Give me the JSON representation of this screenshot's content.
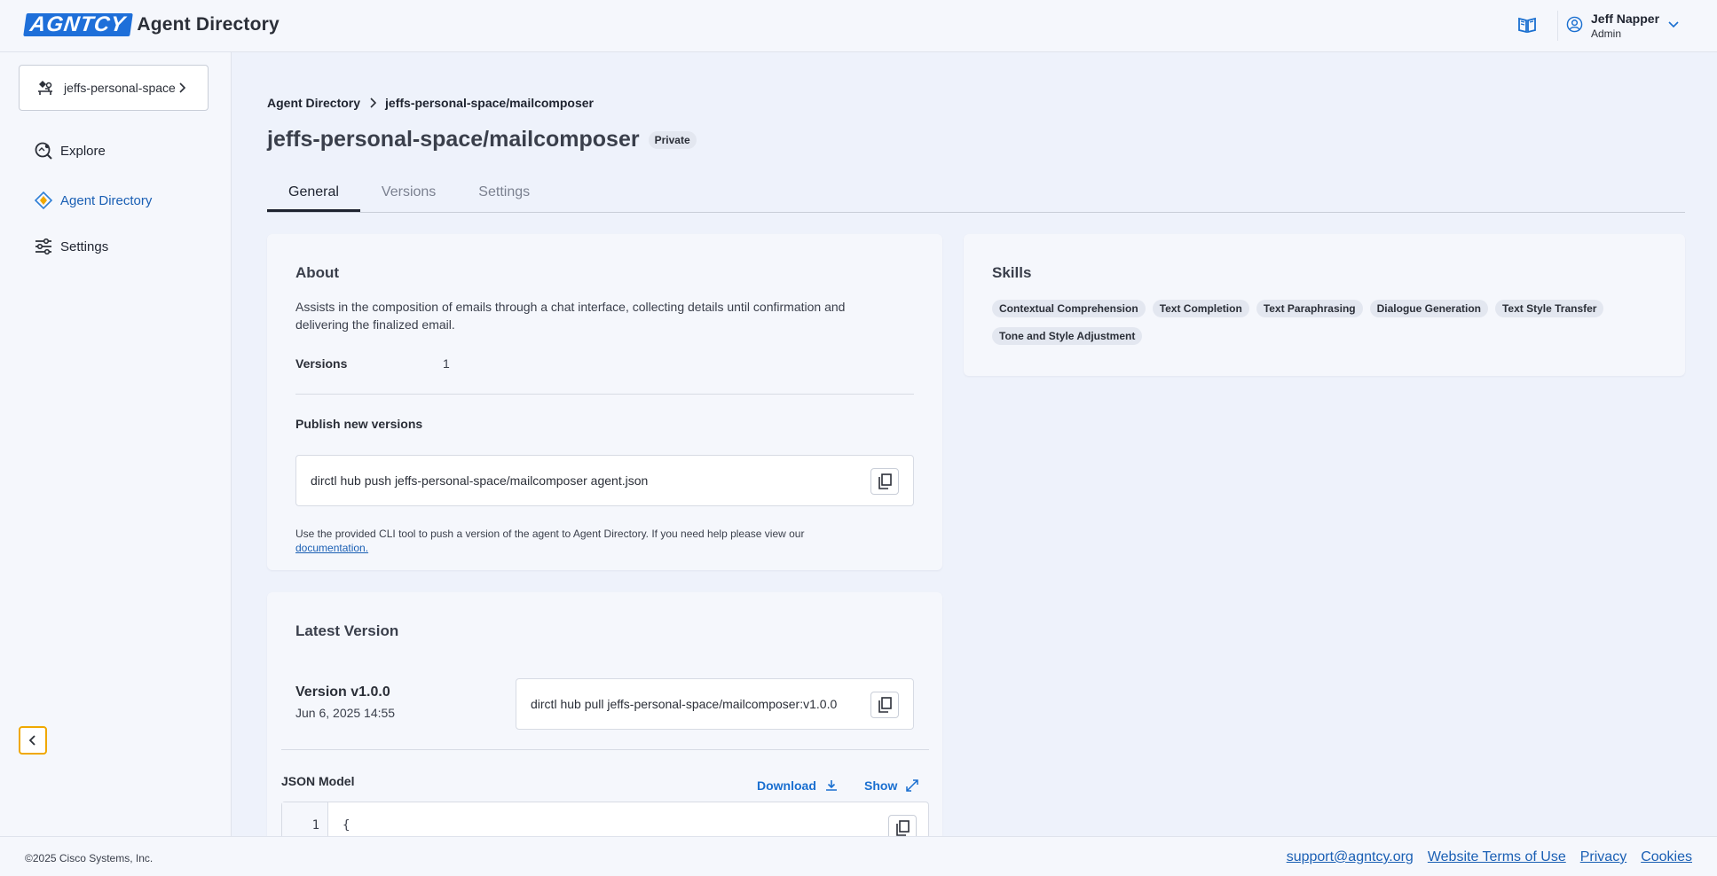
{
  "header": {
    "brand_badge": "AGNTCY",
    "brand_name": "Agent Directory",
    "book_icon": "book-icon",
    "user": {
      "name": "Jeff Napper",
      "role": "Admin"
    }
  },
  "sidebar": {
    "space": "jeffs-personal-space",
    "items": [
      {
        "label": "Explore",
        "icon": "explore-icon"
      },
      {
        "label": "Agent Directory",
        "icon": "agent-directory-icon",
        "active": true
      },
      {
        "label": "Settings",
        "icon": "sliders-icon"
      }
    ]
  },
  "breadcrumb": {
    "root": "Agent Directory",
    "current": "jeffs-personal-space/mailcomposer"
  },
  "page": {
    "title": "jeffs-personal-space/mailcomposer",
    "badge": "Private"
  },
  "tabs": [
    "General",
    "Versions",
    "Settings"
  ],
  "about": {
    "title": "About",
    "description": "Assists in the composition of emails through a chat interface, collecting details until confirmation and delivering the finalized email.",
    "versions_label": "Versions",
    "versions_value": "1",
    "publish_label": "Publish new versions",
    "push_command": "dirctl hub push jeffs-personal-space/mailcomposer agent.json",
    "help_text": "Use the provided CLI tool to push a version of the agent to Agent Directory. If you need help please view our",
    "help_link": "documentation."
  },
  "skills": {
    "title": "Skills",
    "items": [
      "Contextual Comprehension",
      "Text Completion",
      "Text Paraphrasing",
      "Dialogue Generation",
      "Text Style Transfer",
      "Tone and Style Adjustment"
    ]
  },
  "latest": {
    "title": "Latest Version",
    "version": "Version v1.0.0",
    "date": "Jun 6, 2025 14:55",
    "pull_command": "dirctl hub pull jeffs-personal-space/mailcomposer:v1.0.0",
    "json_label": "JSON Model",
    "download_label": "Download",
    "show_label": "Show",
    "code_line_number": "1",
    "code_line": "{"
  },
  "footer": {
    "copyright": "©2025 Cisco Systems, Inc.",
    "links": [
      "support@agntcy.org",
      "Website Terms of Use",
      "Privacy",
      "Cookies"
    ]
  }
}
